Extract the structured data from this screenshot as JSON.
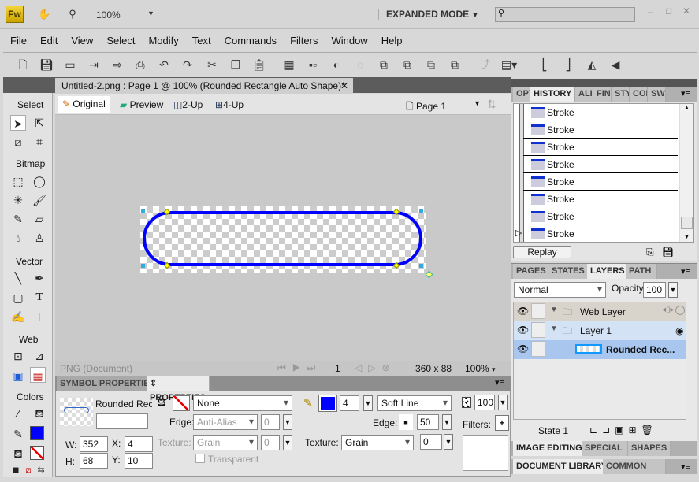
{
  "titlebar": {
    "logo": "Fw",
    "zoom": "100%",
    "mode": "EXPANDED MODE",
    "search_placeholder": "",
    "icons": [
      "hand-icon",
      "zoom-icon"
    ]
  },
  "menu": [
    "File",
    "Edit",
    "View",
    "Select",
    "Modify",
    "Text",
    "Commands",
    "Filters",
    "Window",
    "Help"
  ],
  "toolbar_icons": [
    "new",
    "save",
    "open",
    "import",
    "export",
    "print",
    "undo",
    "redo",
    "cut",
    "copy",
    "paste",
    "group",
    "ungroup",
    "join",
    "split",
    "bring-to-front",
    "bring-forward",
    "send-backward",
    "send-to-back",
    "rotate",
    "align",
    "rotate-90-ccw",
    "rotate-90-cw",
    "flip-horizontal",
    "flip-vertical"
  ],
  "document": {
    "tab_title": "Untitled-2.png : Page 1 @ 100% (Rounded Rectangle Auto Shape)*",
    "views": [
      "Original",
      "Preview",
      "2-Up",
      "4-Up"
    ],
    "page": "Page 1",
    "doc_type": "PNG (Document)",
    "frame": "1",
    "size": "360 x 88",
    "zoom": "100%",
    "stroke_color": "#0000ff"
  },
  "tools": {
    "sections": [
      "Select",
      "Bitmap",
      "Vector",
      "Web",
      "Colors"
    ],
    "stroke_color": "#0000ff"
  },
  "properties": {
    "tabs": [
      "SYMBOL PROPERTIES",
      "PROPERTIES"
    ],
    "name": "Rounded Recta",
    "instance_name": "",
    "w_label": "W:",
    "w": "352",
    "h_label": "H:",
    "h": "68",
    "x_label": "X:",
    "x": "4",
    "y_label": "Y:",
    "y": "10",
    "fill": {
      "type": "None",
      "edge_label": "Edge:",
      "edge": "Anti-Alias",
      "edge_val": "0",
      "texture_label": "Texture:",
      "texture": "Grain",
      "texture_val": "0",
      "transparent": "Transparent"
    },
    "stroke": {
      "color": "#0000ff",
      "size": "4",
      "type": "Soft Line",
      "edge_label": "Edge:",
      "edge": "50",
      "texture_label": "Texture:",
      "texture": "Grain",
      "texture_val": "0"
    },
    "opacity": "100",
    "filters_label": "Filters:"
  },
  "history": {
    "tabs": [
      "OPT",
      "HISTORY",
      "ALI",
      "FIN",
      "STY",
      "COL",
      "SW"
    ],
    "items": [
      "Stroke",
      "Stroke",
      "Stroke",
      "Stroke",
      "Stroke",
      "Stroke",
      "Stroke",
      "Stroke"
    ],
    "replay": "Replay"
  },
  "layers": {
    "tabs": [
      "PAGES",
      "STATES",
      "LAYERS",
      "PATH"
    ],
    "blend": "Normal",
    "opacity_label": "Opacity",
    "opacity": "100",
    "rows": [
      "Web Layer",
      "Layer 1",
      "Rounded Rec..."
    ],
    "state": "State 1"
  },
  "bottom_tabs": [
    "IMAGE EDITING",
    "SPECIAL CH",
    "SHAPES"
  ],
  "library_tabs": [
    "DOCUMENT LIBRARY",
    "COMMON LIBR"
  ]
}
